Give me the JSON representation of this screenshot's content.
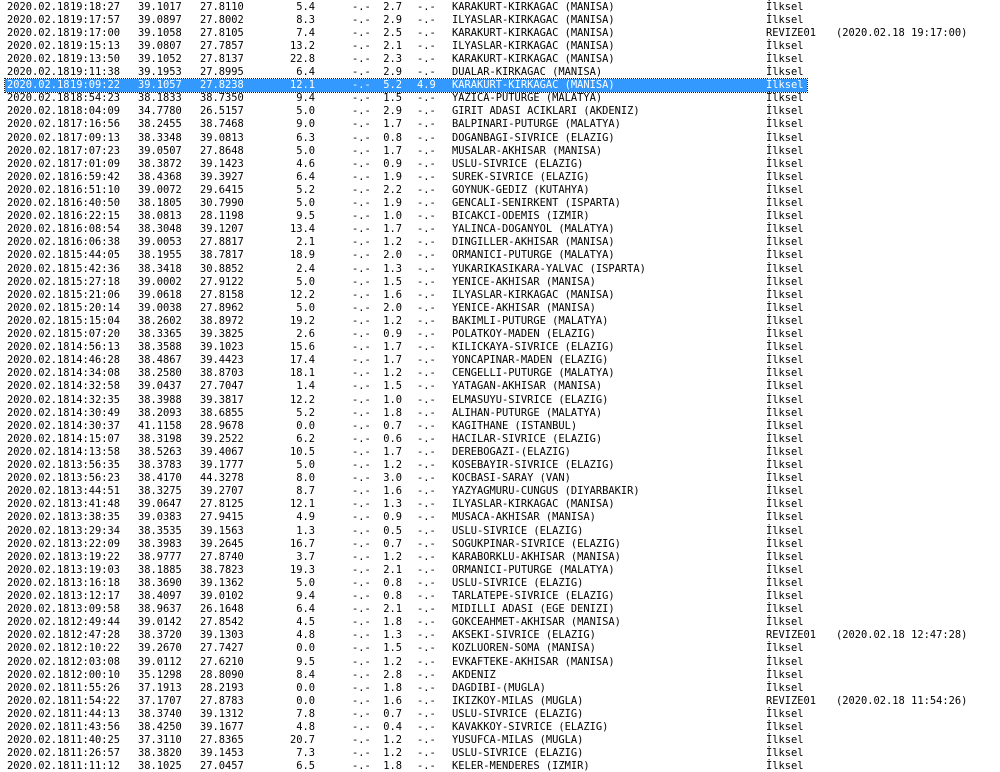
{
  "window": {
    "selected_row_index": 6
  },
  "rows": [
    {
      "date": "2020.02.18",
      "time": "19:18:27",
      "lat": "39.1017",
      "lon": "27.8110",
      "depth": "5.4",
      "md": "-.-",
      "ml": "2.7",
      "mw": "-.-",
      "location": "KARAKURT-KIRKAGAC (MANISA)",
      "type": "İlksel",
      "revise": ""
    },
    {
      "date": "2020.02.18",
      "time": "19:17:57",
      "lat": "39.0897",
      "lon": "27.8002",
      "depth": "8.3",
      "md": "-.-",
      "ml": "2.9",
      "mw": "-.-",
      "location": "ILYASLAR-KIRKAGAC (MANISA)",
      "type": "İlksel",
      "revise": ""
    },
    {
      "date": "2020.02.18",
      "time": "19:17:00",
      "lat": "39.1058",
      "lon": "27.8105",
      "depth": "7.4",
      "md": "-.-",
      "ml": "2.5",
      "mw": "-.-",
      "location": "KARAKURT-KIRKAGAC (MANISA)",
      "type": "REVIZE01",
      "revise": "(2020.02.18 19:17:00)"
    },
    {
      "date": "2020.02.18",
      "time": "19:15:13",
      "lat": "39.0807",
      "lon": "27.7857",
      "depth": "13.2",
      "md": "-.-",
      "ml": "2.1",
      "mw": "-.-",
      "location": "ILYASLAR-KIRKAGAC (MANISA)",
      "type": "İlksel",
      "revise": ""
    },
    {
      "date": "2020.02.18",
      "time": "19:13:50",
      "lat": "39.1052",
      "lon": "27.8137",
      "depth": "22.8",
      "md": "-.-",
      "ml": "2.3",
      "mw": "-.-",
      "location": "KARAKURT-KIRKAGAC (MANISA)",
      "type": "İlksel",
      "revise": ""
    },
    {
      "date": "2020.02.18",
      "time": "19:11:38",
      "lat": "39.1953",
      "lon": "27.8995",
      "depth": "6.4",
      "md": "-.-",
      "ml": "2.9",
      "mw": "-.-",
      "location": "DUALAR-KIRKAGAC (MANISA)",
      "type": "İlksel",
      "revise": ""
    },
    {
      "date": "2020.02.18",
      "time": "19:09:22",
      "lat": "39.1057",
      "lon": "27.8238",
      "depth": "12.1",
      "md": "-.-",
      "ml": "5.2",
      "mw": "4.9",
      "location": "KARAKURT-KIRKAGAC (MANISA)",
      "type": "İlksel",
      "revise": ""
    },
    {
      "date": "2020.02.18",
      "time": "18:54:23",
      "lat": "38.1833",
      "lon": "38.7350",
      "depth": "9.4",
      "md": "-.-",
      "ml": "1.5",
      "mw": "-.-",
      "location": "YAZICA-PUTURGE (MALATYA)",
      "type": "İlksel",
      "revise": ""
    },
    {
      "date": "2020.02.18",
      "time": "18:04:09",
      "lat": "34.7780",
      "lon": "26.5157",
      "depth": "5.0",
      "md": "-.-",
      "ml": "2.9",
      "mw": "-.-",
      "location": "GIRIT ADASI ACIKLARI (AKDENIZ)",
      "type": "İlksel",
      "revise": ""
    },
    {
      "date": "2020.02.18",
      "time": "17:16:56",
      "lat": "38.2455",
      "lon": "38.7468",
      "depth": "9.0",
      "md": "-.-",
      "ml": "1.7",
      "mw": "-.-",
      "location": "BALPINARI-PUTURGE (MALATYA)",
      "type": "İlksel",
      "revise": ""
    },
    {
      "date": "2020.02.18",
      "time": "17:09:13",
      "lat": "38.3348",
      "lon": "39.0813",
      "depth": "6.3",
      "md": "-.-",
      "ml": "0.8",
      "mw": "-.-",
      "location": "DOGANBAGI-SIVRICE (ELAZIG)",
      "type": "İlksel",
      "revise": ""
    },
    {
      "date": "2020.02.18",
      "time": "17:07:23",
      "lat": "39.0507",
      "lon": "27.8648",
      "depth": "5.0",
      "md": "-.-",
      "ml": "1.7",
      "mw": "-.-",
      "location": "MUSALAR-AKHISAR (MANISA)",
      "type": "İlksel",
      "revise": ""
    },
    {
      "date": "2020.02.18",
      "time": "17:01:09",
      "lat": "38.3872",
      "lon": "39.1423",
      "depth": "4.6",
      "md": "-.-",
      "ml": "0.9",
      "mw": "-.-",
      "location": "USLU-SIVRICE (ELAZIG)",
      "type": "İlksel",
      "revise": ""
    },
    {
      "date": "2020.02.18",
      "time": "16:59:42",
      "lat": "38.4368",
      "lon": "39.3927",
      "depth": "6.4",
      "md": "-.-",
      "ml": "1.9",
      "mw": "-.-",
      "location": "SUREK-SIVRICE (ELAZIG)",
      "type": "İlksel",
      "revise": ""
    },
    {
      "date": "2020.02.18",
      "time": "16:51:10",
      "lat": "39.0072",
      "lon": "29.6415",
      "depth": "5.2",
      "md": "-.-",
      "ml": "2.2",
      "mw": "-.-",
      "location": "GOYNUK-GEDIZ (KUTAHYA)",
      "type": "İlksel",
      "revise": ""
    },
    {
      "date": "2020.02.18",
      "time": "16:40:50",
      "lat": "38.1805",
      "lon": "30.7990",
      "depth": "5.0",
      "md": "-.-",
      "ml": "1.9",
      "mw": "-.-",
      "location": "GENCALI-SENIRKENT (ISPARTA)",
      "type": "İlksel",
      "revise": ""
    },
    {
      "date": "2020.02.18",
      "time": "16:22:15",
      "lat": "38.0813",
      "lon": "28.1198",
      "depth": "9.5",
      "md": "-.-",
      "ml": "1.0",
      "mw": "-.-",
      "location": "BICAKCI-ODEMIS (IZMIR)",
      "type": "İlksel",
      "revise": ""
    },
    {
      "date": "2020.02.18",
      "time": "16:08:54",
      "lat": "38.3048",
      "lon": "39.1207",
      "depth": "13.4",
      "md": "-.-",
      "ml": "1.7",
      "mw": "-.-",
      "location": "YALINCA-DOGANYOL (MALATYA)",
      "type": "İlksel",
      "revise": ""
    },
    {
      "date": "2020.02.18",
      "time": "16:06:38",
      "lat": "39.0053",
      "lon": "27.8817",
      "depth": "2.1",
      "md": "-.-",
      "ml": "1.2",
      "mw": "-.-",
      "location": "DINGILLER-AKHISAR (MANISA)",
      "type": "İlksel",
      "revise": ""
    },
    {
      "date": "2020.02.18",
      "time": "15:44:05",
      "lat": "38.1955",
      "lon": "38.7817",
      "depth": "18.9",
      "md": "-.-",
      "ml": "2.0",
      "mw": "-.-",
      "location": "ORMANICI-PUTURGE (MALATYA)",
      "type": "İlksel",
      "revise": ""
    },
    {
      "date": "2020.02.18",
      "time": "15:42:36",
      "lat": "38.3418",
      "lon": "30.8852",
      "depth": "2.4",
      "md": "-.-",
      "ml": "1.3",
      "mw": "-.-",
      "location": "YUKARIKASIKARA-YALVAC (ISPARTA)",
      "type": "İlksel",
      "revise": ""
    },
    {
      "date": "2020.02.18",
      "time": "15:27:18",
      "lat": "39.0002",
      "lon": "27.9122",
      "depth": "5.0",
      "md": "-.-",
      "ml": "1.5",
      "mw": "-.-",
      "location": "YENICE-AKHISAR (MANISA)",
      "type": "İlksel",
      "revise": ""
    },
    {
      "date": "2020.02.18",
      "time": "15:21:06",
      "lat": "39.0618",
      "lon": "27.8158",
      "depth": "12.2",
      "md": "-.-",
      "ml": "1.6",
      "mw": "-.-",
      "location": "ILYASLAR-KIRKAGAC (MANISA)",
      "type": "İlksel",
      "revise": ""
    },
    {
      "date": "2020.02.18",
      "time": "15:20:14",
      "lat": "39.0038",
      "lon": "27.8962",
      "depth": "5.0",
      "md": "-.-",
      "ml": "2.0",
      "mw": "-.-",
      "location": "YENICE-AKHISAR (MANISA)",
      "type": "İlksel",
      "revise": ""
    },
    {
      "date": "2020.02.18",
      "time": "15:15:04",
      "lat": "38.2602",
      "lon": "38.8972",
      "depth": "19.2",
      "md": "-.-",
      "ml": "1.2",
      "mw": "-.-",
      "location": "BAKIMLI-PUTURGE (MALATYA)",
      "type": "İlksel",
      "revise": ""
    },
    {
      "date": "2020.02.18",
      "time": "15:07:20",
      "lat": "38.3365",
      "lon": "39.3825",
      "depth": "2.6",
      "md": "-.-",
      "ml": "0.9",
      "mw": "-.-",
      "location": "POLATKOY-MADEN (ELAZIG)",
      "type": "İlksel",
      "revise": ""
    },
    {
      "date": "2020.02.18",
      "time": "14:56:13",
      "lat": "38.3588",
      "lon": "39.1023",
      "depth": "15.6",
      "md": "-.-",
      "ml": "1.7",
      "mw": "-.-",
      "location": "KILICKAYA-SIVRICE (ELAZIG)",
      "type": "İlksel",
      "revise": ""
    },
    {
      "date": "2020.02.18",
      "time": "14:46:28",
      "lat": "38.4867",
      "lon": "39.4423",
      "depth": "17.4",
      "md": "-.-",
      "ml": "1.7",
      "mw": "-.-",
      "location": "YONCAPINAR-MADEN (ELAZIG)",
      "type": "İlksel",
      "revise": ""
    },
    {
      "date": "2020.02.18",
      "time": "14:34:08",
      "lat": "38.2580",
      "lon": "38.8703",
      "depth": "18.1",
      "md": "-.-",
      "ml": "1.2",
      "mw": "-.-",
      "location": "CENGELLI-PUTURGE (MALATYA)",
      "type": "İlksel",
      "revise": ""
    },
    {
      "date": "2020.02.18",
      "time": "14:32:58",
      "lat": "39.0437",
      "lon": "27.7047",
      "depth": "1.4",
      "md": "-.-",
      "ml": "1.5",
      "mw": "-.-",
      "location": "YATAGAN-AKHISAR (MANISA)",
      "type": "İlksel",
      "revise": ""
    },
    {
      "date": "2020.02.18",
      "time": "14:32:35",
      "lat": "38.3988",
      "lon": "39.3817",
      "depth": "12.2",
      "md": "-.-",
      "ml": "1.0",
      "mw": "-.-",
      "location": "ELMASUYU-SIVRICE (ELAZIG)",
      "type": "İlksel",
      "revise": ""
    },
    {
      "date": "2020.02.18",
      "time": "14:30:49",
      "lat": "38.2093",
      "lon": "38.6855",
      "depth": "5.2",
      "md": "-.-",
      "ml": "1.8",
      "mw": "-.-",
      "location": "ALIHAN-PUTURGE (MALATYA)",
      "type": "İlksel",
      "revise": ""
    },
    {
      "date": "2020.02.18",
      "time": "14:30:37",
      "lat": "41.1158",
      "lon": "28.9678",
      "depth": "0.0",
      "md": "-.-",
      "ml": "0.7",
      "mw": "-.-",
      "location": "KAGITHANE (ISTANBUL)",
      "type": "İlksel",
      "revise": ""
    },
    {
      "date": "2020.02.18",
      "time": "14:15:07",
      "lat": "38.3198",
      "lon": "39.2522",
      "depth": "6.2",
      "md": "-.-",
      "ml": "0.6",
      "mw": "-.-",
      "location": "HACILAR-SIVRICE (ELAZIG)",
      "type": "İlksel",
      "revise": ""
    },
    {
      "date": "2020.02.18",
      "time": "14:13:58",
      "lat": "38.5263",
      "lon": "39.4067",
      "depth": "10.5",
      "md": "-.-",
      "ml": "1.7",
      "mw": "-.-",
      "location": "DEREBOGAZI-(ELAZIG)",
      "type": "İlksel",
      "revise": ""
    },
    {
      "date": "2020.02.18",
      "time": "13:56:35",
      "lat": "38.3783",
      "lon": "39.1777",
      "depth": "5.0",
      "md": "-.-",
      "ml": "1.2",
      "mw": "-.-",
      "location": "KOSEBAYIR-SIVRICE (ELAZIG)",
      "type": "İlksel",
      "revise": ""
    },
    {
      "date": "2020.02.18",
      "time": "13:56:23",
      "lat": "38.4170",
      "lon": "44.3278",
      "depth": "8.0",
      "md": "-.-",
      "ml": "3.0",
      "mw": "-.-",
      "location": "KOCBASI-SARAY (VAN)",
      "type": "İlksel",
      "revise": ""
    },
    {
      "date": "2020.02.18",
      "time": "13:44:51",
      "lat": "38.3275",
      "lon": "39.2707",
      "depth": "8.7",
      "md": "-.-",
      "ml": "1.6",
      "mw": "-.-",
      "location": "YAZYAGMURU-CUNGUS (DIYARBAKIR)",
      "type": "İlksel",
      "revise": ""
    },
    {
      "date": "2020.02.18",
      "time": "13:41:48",
      "lat": "39.0647",
      "lon": "27.8125",
      "depth": "12.1",
      "md": "-.-",
      "ml": "1.3",
      "mw": "-.-",
      "location": "ILYASLAR-KIRKAGAC (MANISA)",
      "type": "İlksel",
      "revise": ""
    },
    {
      "date": "2020.02.18",
      "time": "13:38:35",
      "lat": "39.0383",
      "lon": "27.9415",
      "depth": "4.9",
      "md": "-.-",
      "ml": "0.9",
      "mw": "-.-",
      "location": "MUSACA-AKHISAR (MANISA)",
      "type": "İlksel",
      "revise": ""
    },
    {
      "date": "2020.02.18",
      "time": "13:29:34",
      "lat": "38.3535",
      "lon": "39.1563",
      "depth": "1.3",
      "md": "-.-",
      "ml": "0.5",
      "mw": "-.-",
      "location": "USLU-SIVRICE (ELAZIG)",
      "type": "İlksel",
      "revise": ""
    },
    {
      "date": "2020.02.18",
      "time": "13:22:09",
      "lat": "38.3983",
      "lon": "39.2645",
      "depth": "16.7",
      "md": "-.-",
      "ml": "0.7",
      "mw": "-.-",
      "location": "SOGUKPINAR-SIVRICE (ELAZIG)",
      "type": "İlksel",
      "revise": ""
    },
    {
      "date": "2020.02.18",
      "time": "13:19:22",
      "lat": "38.9777",
      "lon": "27.8740",
      "depth": "3.7",
      "md": "-.-",
      "ml": "1.2",
      "mw": "-.-",
      "location": "KARABORKLU-AKHISAR (MANISA)",
      "type": "İlksel",
      "revise": ""
    },
    {
      "date": "2020.02.18",
      "time": "13:19:03",
      "lat": "38.1885",
      "lon": "38.7823",
      "depth": "19.3",
      "md": "-.-",
      "ml": "2.1",
      "mw": "-.-",
      "location": "ORMANICI-PUTURGE (MALATYA)",
      "type": "İlksel",
      "revise": ""
    },
    {
      "date": "2020.02.18",
      "time": "13:16:18",
      "lat": "38.3690",
      "lon": "39.1362",
      "depth": "5.0",
      "md": "-.-",
      "ml": "0.8",
      "mw": "-.-",
      "location": "USLU-SIVRICE (ELAZIG)",
      "type": "İlksel",
      "revise": ""
    },
    {
      "date": "2020.02.18",
      "time": "13:12:17",
      "lat": "38.4097",
      "lon": "39.0102",
      "depth": "9.4",
      "md": "-.-",
      "ml": "0.8",
      "mw": "-.-",
      "location": "TARLATEPE-SIVRICE (ELAZIG)",
      "type": "İlksel",
      "revise": ""
    },
    {
      "date": "2020.02.18",
      "time": "13:09:58",
      "lat": "38.9637",
      "lon": "26.1648",
      "depth": "6.4",
      "md": "-.-",
      "ml": "2.1",
      "mw": "-.-",
      "location": "MIDILLI ADASI (EGE DENIZI)",
      "type": "İlksel",
      "revise": ""
    },
    {
      "date": "2020.02.18",
      "time": "12:49:44",
      "lat": "39.0142",
      "lon": "27.8542",
      "depth": "4.5",
      "md": "-.-",
      "ml": "1.8",
      "mw": "-.-",
      "location": "GOKCEAHMET-AKHISAR (MANISA)",
      "type": "İlksel",
      "revise": ""
    },
    {
      "date": "2020.02.18",
      "time": "12:47:28",
      "lat": "38.3720",
      "lon": "39.1303",
      "depth": "4.8",
      "md": "-.-",
      "ml": "1.3",
      "mw": "-.-",
      "location": "AKSEKI-SIVRICE (ELAZIG)",
      "type": "REVIZE01",
      "revise": "(2020.02.18 12:47:28)"
    },
    {
      "date": "2020.02.18",
      "time": "12:10:22",
      "lat": "39.2670",
      "lon": "27.7427",
      "depth": "0.0",
      "md": "-.-",
      "ml": "1.5",
      "mw": "-.-",
      "location": "KOZLUOREN-SOMA (MANISA)",
      "type": "İlksel",
      "revise": ""
    },
    {
      "date": "2020.02.18",
      "time": "12:03:08",
      "lat": "39.0112",
      "lon": "27.6210",
      "depth": "9.5",
      "md": "-.-",
      "ml": "1.2",
      "mw": "-.-",
      "location": "EVKAFTEKE-AKHISAR (MANISA)",
      "type": "İlksel",
      "revise": ""
    },
    {
      "date": "2020.02.18",
      "time": "12:00:10",
      "lat": "35.1298",
      "lon": "28.8090",
      "depth": "8.4",
      "md": "-.-",
      "ml": "2.8",
      "mw": "-.-",
      "location": "AKDENIZ",
      "type": "İlksel",
      "revise": ""
    },
    {
      "date": "2020.02.18",
      "time": "11:55:26",
      "lat": "37.1913",
      "lon": "28.2193",
      "depth": "0.0",
      "md": "-.-",
      "ml": "1.8",
      "mw": "-.-",
      "location": "DAGDIBI-(MUGLA)",
      "type": "İlksel",
      "revise": ""
    },
    {
      "date": "2020.02.18",
      "time": "11:54:22",
      "lat": "37.1707",
      "lon": "27.8783",
      "depth": "0.0",
      "md": "-.-",
      "ml": "1.6",
      "mw": "-.-",
      "location": "IKIZKOY-MILAS (MUGLA)",
      "type": "REVIZE01",
      "revise": "(2020.02.18 11:54:26)"
    },
    {
      "date": "2020.02.18",
      "time": "11:44:13",
      "lat": "38.3740",
      "lon": "39.1312",
      "depth": "7.8",
      "md": "-.-",
      "ml": "0.7",
      "mw": "-.-",
      "location": "USLU-SIVRICE (ELAZIG)",
      "type": "İlksel",
      "revise": ""
    },
    {
      "date": "2020.02.18",
      "time": "11:43:56",
      "lat": "38.4250",
      "lon": "39.1677",
      "depth": "4.8",
      "md": "-.-",
      "ml": "0.4",
      "mw": "-.-",
      "location": "KAVAKKOY-SIVRICE (ELAZIG)",
      "type": "İlksel",
      "revise": ""
    },
    {
      "date": "2020.02.18",
      "time": "11:40:25",
      "lat": "37.3110",
      "lon": "27.8365",
      "depth": "20.7",
      "md": "-.-",
      "ml": "1.2",
      "mw": "-.-",
      "location": "YUSUFCA-MILAS (MUGLA)",
      "type": "İlksel",
      "revise": ""
    },
    {
      "date": "2020.02.18",
      "time": "11:26:57",
      "lat": "38.3820",
      "lon": "39.1453",
      "depth": "7.3",
      "md": "-.-",
      "ml": "1.2",
      "mw": "-.-",
      "location": "USLU-SIVRICE (ELAZIG)",
      "type": "İlksel",
      "revise": ""
    },
    {
      "date": "2020.02.18",
      "time": "11:11:12",
      "lat": "38.1025",
      "lon": "27.0457",
      "depth": "6.5",
      "md": "-.-",
      "ml": "1.8",
      "mw": "-.-",
      "location": "KELER-MENDERES (IZMIR)",
      "type": "İlksel",
      "revise": ""
    }
  ]
}
